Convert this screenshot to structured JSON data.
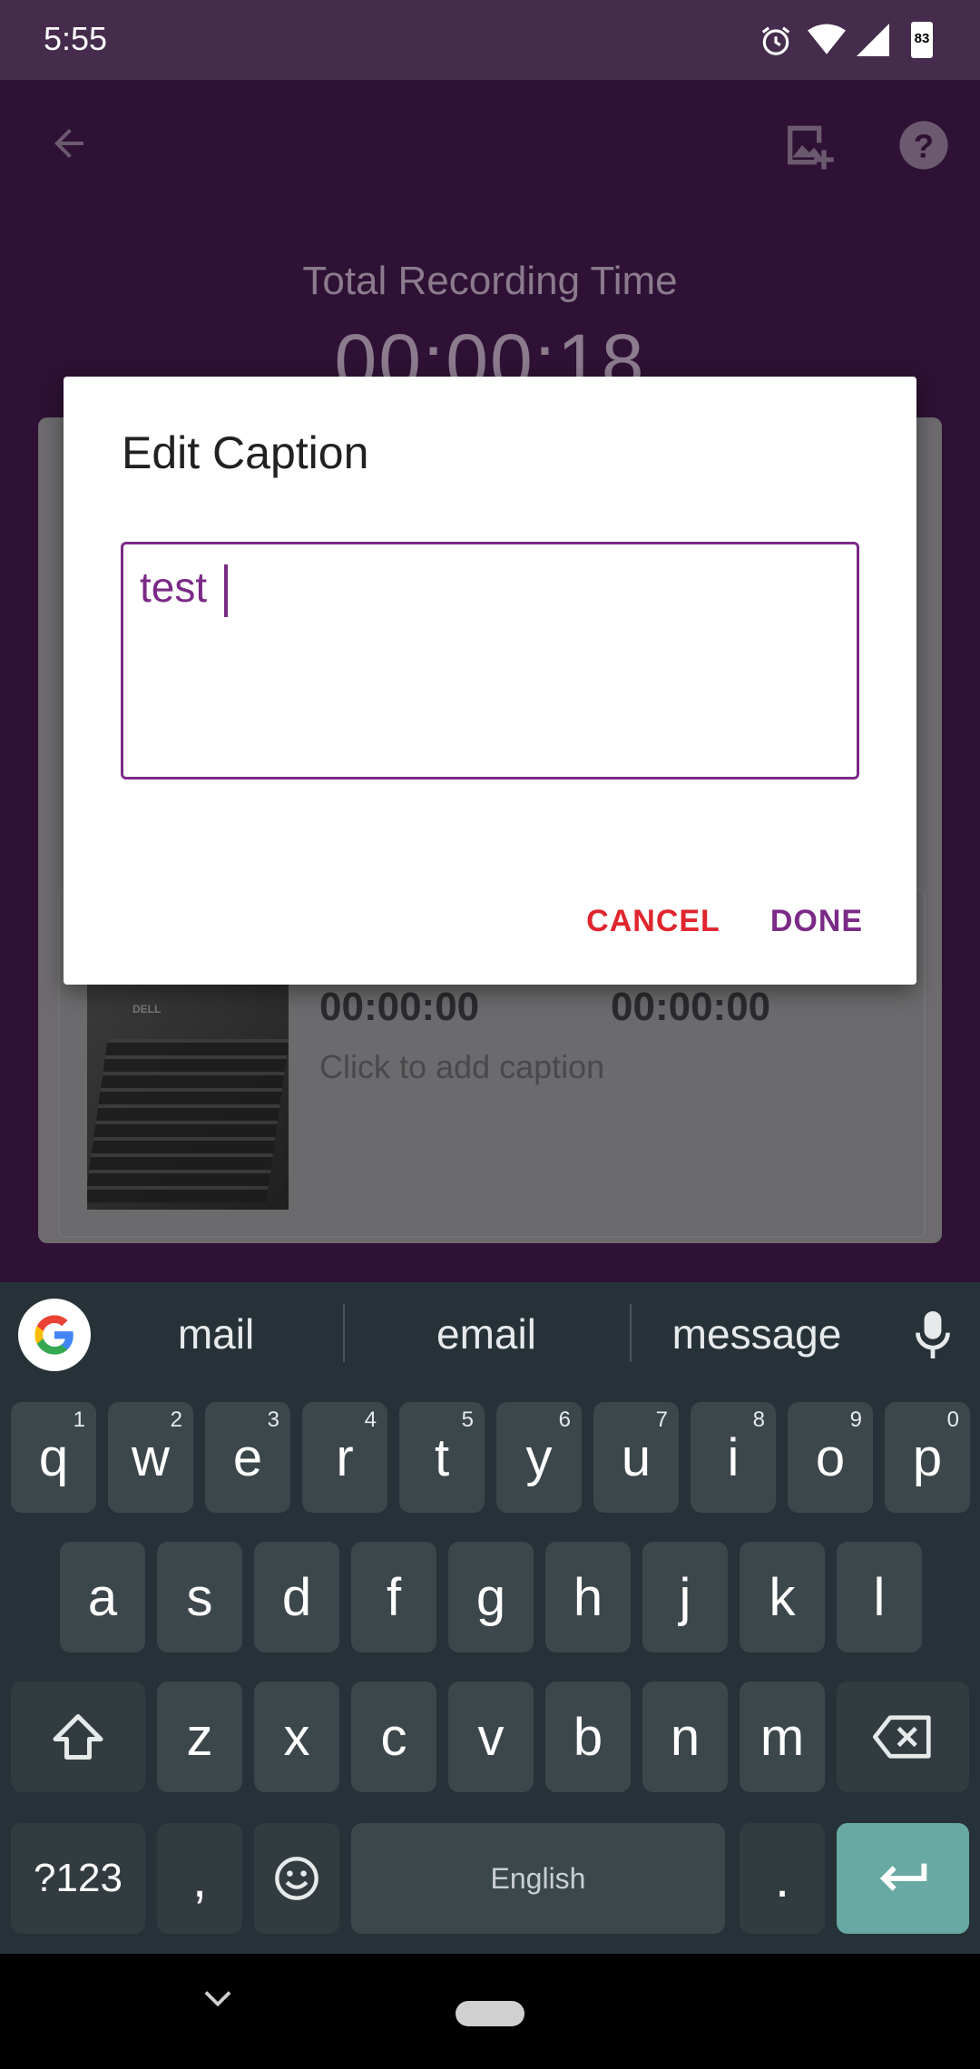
{
  "status_bar": {
    "time": "5:55",
    "battery": "83"
  },
  "header": {
    "total_label": "Total Recording Time",
    "total_time": "00:00:18"
  },
  "card": {
    "start_time": "00:00:00",
    "end_time": "00:00:00",
    "caption_hint": "Click to add caption",
    "thumbnail_brand": "DELL"
  },
  "dialog": {
    "title": "Edit Caption",
    "caption_value": "test ",
    "cancel_label": "CANCEL",
    "done_label": "DONE"
  },
  "keyboard": {
    "suggestions": [
      "mail",
      "email",
      "message"
    ],
    "row1": [
      "q",
      "w",
      "e",
      "r",
      "t",
      "y",
      "u",
      "i",
      "o",
      "p"
    ],
    "row1_hints": [
      "1",
      "2",
      "3",
      "4",
      "5",
      "6",
      "7",
      "8",
      "9",
      "0"
    ],
    "row2": [
      "a",
      "s",
      "d",
      "f",
      "g",
      "h",
      "j",
      "k",
      "l"
    ],
    "row3": [
      "z",
      "x",
      "c",
      "v",
      "b",
      "n",
      "m"
    ],
    "symbols_label": "?123",
    "comma": ",",
    "space_label": "English",
    "period": "."
  },
  "colors": {
    "accent": "#7b2a87",
    "cancel": "#e0252e",
    "enter_key": "#68aaa3",
    "app_bg": "#2e1134"
  }
}
